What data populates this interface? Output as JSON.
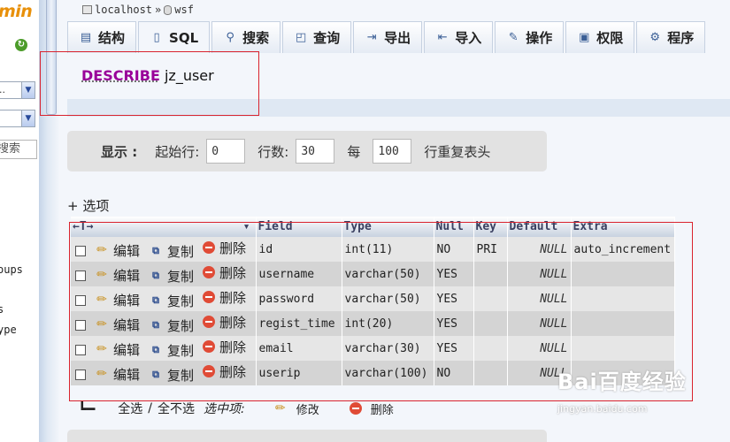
{
  "left_nav": {
    "logo_text": "min",
    "db_select_value": "..",
    "table_select_value": "",
    "search_text": "搜索",
    "items": [
      "oups",
      "s",
      "ype"
    ]
  },
  "breadcrumb": {
    "server": "localhost",
    "separator": "»",
    "database": "wsf"
  },
  "tabs": [
    {
      "label": "结构",
      "icon": "structure-icon"
    },
    {
      "label": "SQL",
      "icon": "sql-icon"
    },
    {
      "label": "搜索",
      "icon": "search-icon"
    },
    {
      "label": "查询",
      "icon": "query-icon"
    },
    {
      "label": "导出",
      "icon": "export-icon"
    },
    {
      "label": "导入",
      "icon": "import-icon"
    },
    {
      "label": "操作",
      "icon": "operations-icon"
    },
    {
      "label": "权限",
      "icon": "privileges-icon"
    },
    {
      "label": "程序",
      "icon": "routines-icon"
    }
  ],
  "sql": {
    "keyword": "DESCRIBE",
    "table": "jz_user"
  },
  "display": {
    "show_label": "显示 :",
    "start_row_label": "起始行:",
    "start_row": "0",
    "rows_label": "行数:",
    "rows": "30",
    "every_label": "每",
    "repeat": "100",
    "repeat_label": "行重复表头"
  },
  "options_link": "+ 选项",
  "table": {
    "sort_arrows": "←T→",
    "columns": [
      "Field",
      "Type",
      "Null",
      "Key",
      "Default",
      "Extra"
    ],
    "action_labels": {
      "edit": "编辑",
      "copy": "复制",
      "delete": "删除"
    },
    "rows": [
      {
        "field": "id",
        "type": "int(11)",
        "null": "NO",
        "key": "PRI",
        "default": "NULL",
        "extra": "auto_increment"
      },
      {
        "field": "username",
        "type": "varchar(50)",
        "null": "YES",
        "key": "",
        "default": "NULL",
        "extra": ""
      },
      {
        "field": "password",
        "type": "varchar(50)",
        "null": "YES",
        "key": "",
        "default": "NULL",
        "extra": ""
      },
      {
        "field": "regist_time",
        "type": "int(20)",
        "null": "YES",
        "key": "",
        "default": "NULL",
        "extra": ""
      },
      {
        "field": "email",
        "type": "varchar(30)",
        "null": "YES",
        "key": "",
        "default": "NULL",
        "extra": ""
      },
      {
        "field": "userip",
        "type": "varchar(100)",
        "null": "NO",
        "key": "",
        "default": "NULL",
        "extra": ""
      }
    ]
  },
  "selection": {
    "check_all": "全选",
    "separator": "/",
    "uncheck_all": "全不选",
    "with_selected": "选中项:",
    "edit": "修改",
    "delete": "删除"
  },
  "watermark": {
    "brand": "Bai百度经验",
    "url": "jingyan.baidu.com"
  },
  "colors": {
    "highlight_box": "#d9232e",
    "sql_keyword": "#990099"
  }
}
